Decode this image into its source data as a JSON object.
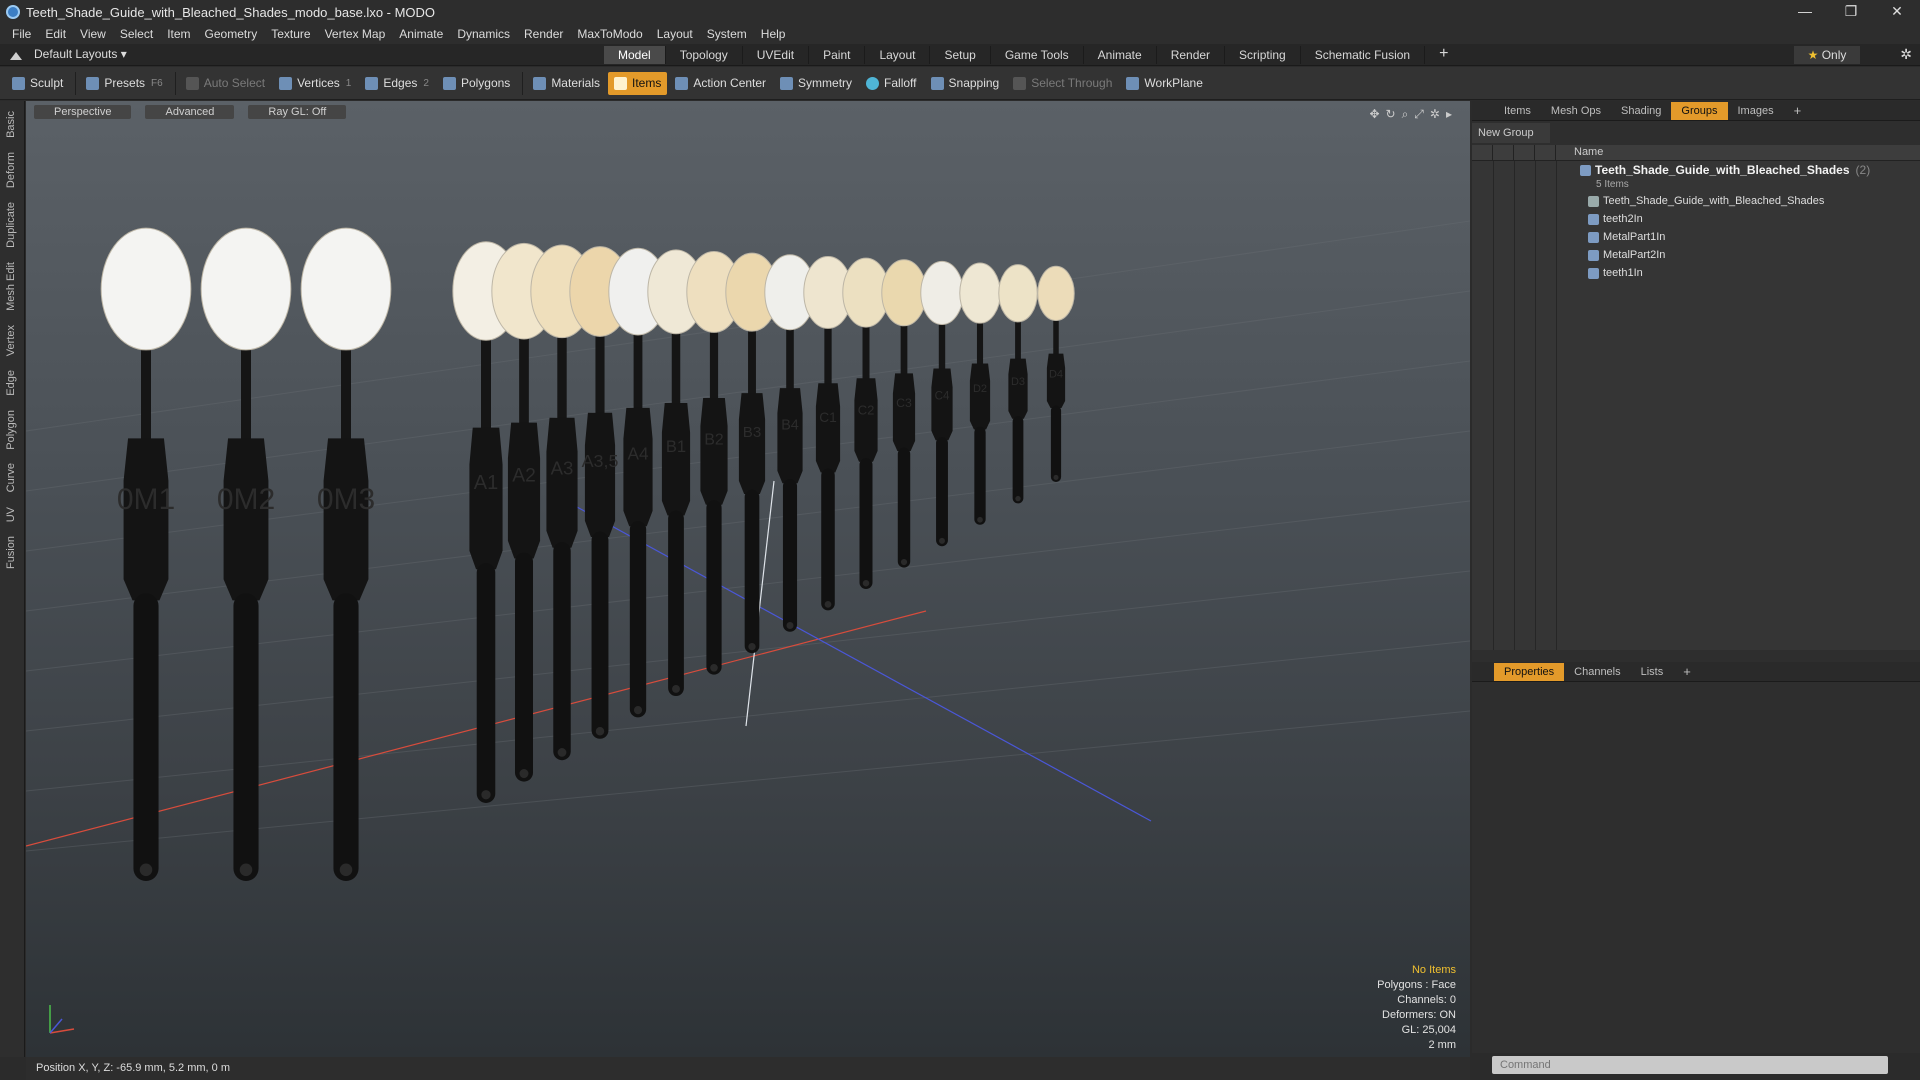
{
  "window": {
    "title": "Teeth_Shade_Guide_with_Bleached_Shades_modo_base.lxo - MODO",
    "controls": [
      "—",
      "❐",
      "✕"
    ]
  },
  "menu": [
    "File",
    "Edit",
    "View",
    "Select",
    "Item",
    "Geometry",
    "Texture",
    "Vertex Map",
    "Animate",
    "Dynamics",
    "Render",
    "MaxToModo",
    "Layout",
    "System",
    "Help"
  ],
  "layouts": {
    "label": "Default Layouts ▾"
  },
  "mode_tabs": [
    "Model",
    "Topology",
    "UVEdit",
    "Paint",
    "Layout",
    "Setup",
    "Game Tools",
    "Animate",
    "Render",
    "Scripting",
    "Schematic Fusion"
  ],
  "active_mode_tab": "Model",
  "only": {
    "star": "★",
    "label": "Only"
  },
  "toolbar": {
    "sculpt": "Sculpt",
    "presets": "Presets",
    "presets_key": "F6",
    "auto_select": "Auto Select",
    "vertices": "Vertices",
    "vertices_count": "1",
    "edges": "Edges",
    "edges_count": "2",
    "polygons": "Polygons",
    "materials": "Materials",
    "items": "Items",
    "action_center": "Action Center",
    "symmetry": "Symmetry",
    "falloff": "Falloff",
    "snapping": "Snapping",
    "select_through": "Select Through",
    "workplane": "WorkPlane"
  },
  "left_tabs": [
    "Basic",
    "Deform",
    "Duplicate",
    "Mesh Edit",
    "Vertex",
    "Edge",
    "Polygon",
    "Curve",
    "UV",
    "Fusion"
  ],
  "viewport": {
    "view_mode": "Perspective",
    "shading": "Advanced",
    "raygl": "Ray GL: Off",
    "shade_labels": [
      "0M1",
      "0M2",
      "0M3",
      "A1",
      "A2",
      "A3",
      "A3,5",
      "A4",
      "B1",
      "B2",
      "B3",
      "B4",
      "C1",
      "C2",
      "C3",
      "C4",
      "D2",
      "D3",
      "D4"
    ],
    "readout": {
      "selection": "No Items",
      "polygons": "Polygons : Face",
      "channels": "Channels: 0",
      "deformers": "Deformers: ON",
      "gl": "GL: 25,004",
      "scale": "2 mm"
    }
  },
  "status": {
    "position": "Position X, Y, Z:  -65.9 mm, 5.2 mm, 0 m"
  },
  "top_panel": {
    "tabs": [
      "Items",
      "Mesh Ops",
      "Shading",
      "Groups",
      "Images"
    ],
    "active_tab": "Groups",
    "new_group": "New Group",
    "name_header": "Name",
    "group": {
      "name": "Teeth_Shade_Guide_with_Bleached_Shades",
      "count": "(2)",
      "sub": "5 Items"
    },
    "items": [
      "Teeth_Shade_Guide_with_Bleached_Shades",
      "teeth2In",
      "MetalPart1In",
      "MetalPart2In",
      "teeth1In"
    ]
  },
  "bottom_panel": {
    "tabs": [
      "Properties",
      "Channels",
      "Lists"
    ],
    "active_tab": "Properties"
  },
  "command": {
    "placeholder": "Command"
  },
  "colors": {
    "accent": "#e39a2a",
    "viewport_top": "#5b6167",
    "viewport_bottom": "#2d3236"
  }
}
